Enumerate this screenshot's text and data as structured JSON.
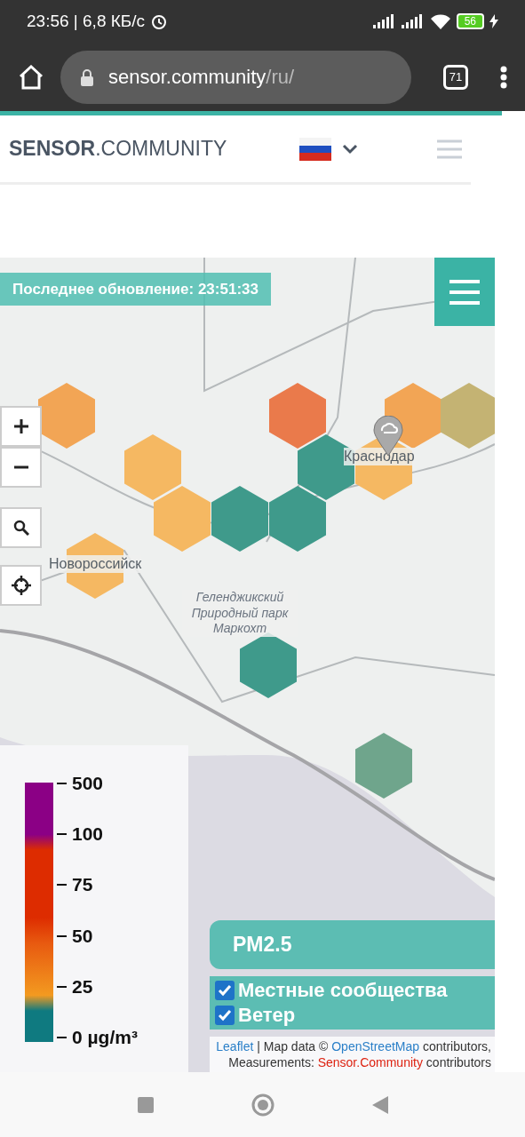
{
  "status_bar": {
    "time": "23:56 | 6,8 КБ/с",
    "battery": "56"
  },
  "browser": {
    "url_host": "sensor.community",
    "url_path": "/ru/",
    "tab_count": "71"
  },
  "header": {
    "logo_bold": "SENSOR",
    "logo_rest": ".COMMUNITY"
  },
  "map": {
    "last_update": "Последнее обновление: 23:51:33",
    "labels": [
      {
        "text": "Краснодар",
        "kind": "city"
      },
      {
        "text": "Новороссийск",
        "kind": "city"
      },
      {
        "text": "Геленджикский Природный парк Маркохт",
        "kind": "park"
      }
    ],
    "hexagons": [
      {
        "color": "#f2a555"
      },
      {
        "color": "#f5b862"
      },
      {
        "color": "#f5b862"
      },
      {
        "color": "#3f9a8b"
      },
      {
        "color": "#3f9a8b"
      },
      {
        "color": "#ea7a4b"
      },
      {
        "color": "#3f9a8b"
      },
      {
        "color": "#f5b862"
      },
      {
        "color": "#f2a555"
      },
      {
        "color": "#c4b373"
      },
      {
        "color": "#f5b862"
      },
      {
        "color": "#3f9a8b"
      },
      {
        "color": "#6fa58c"
      }
    ],
    "legend": {
      "ticks": [
        "500",
        "100",
        "75",
        "50",
        "25",
        "0 µg/m³"
      ]
    },
    "pollutant": "PM2.5",
    "layers": [
      {
        "label": "Местные сообщества",
        "checked": true
      },
      {
        "label": "Ветер",
        "checked": true
      }
    ],
    "attribution": [
      [
        {
          "text": "Leaflet",
          "kind": "link"
        },
        {
          "text": "| Map data ©",
          "kind": "plain"
        },
        {
          "text": "OpenStreetMap",
          "kind": "link"
        },
        {
          "text": "contributors,",
          "kind": "plain"
        }
      ],
      [
        {
          "text": "Measurements:",
          "kind": "plain"
        },
        {
          "text": "Sensor.Community",
          "kind": "red"
        },
        {
          "text": "contributors",
          "kind": "plain"
        }
      ]
    ]
  }
}
